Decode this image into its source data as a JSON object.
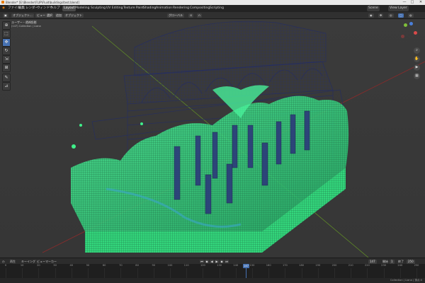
{
  "window": {
    "title": "Blender* [E:\\Blender\\FLIP\\Fluid\\buildings\\test.blend]",
    "controls": [
      "—",
      "□",
      "✕"
    ]
  },
  "menu": {
    "items": [
      "ファイル",
      "編集",
      "レンダー",
      "ウィンドウ",
      "ヘルプ"
    ],
    "workspaces": [
      "Layout",
      "Modeling",
      "Sculpting",
      "UV Editing",
      "Texture Paint",
      "Shading",
      "Animation",
      "Rendering",
      "Compositing",
      "Scripting"
    ],
    "active_workspace": "Layout",
    "scene": "Scene",
    "view_layer": "View Layer"
  },
  "header": {
    "mode": "オブジェクト...",
    "view": "ビュー",
    "select": "選択",
    "add": "追加",
    "object": "オブジェクト",
    "orientation": "グローバル",
    "pivot_icon": "pivot-icon",
    "snap_icon": "magnet-icon"
  },
  "viewport": {
    "overlay_title": "ユーザー・透視投影",
    "overlay_subtitle": "(147) Collection | Liana",
    "tools": [
      "cursor-icon",
      "select-box-icon",
      "move-icon",
      "rotate-icon",
      "scale-icon",
      "transform-icon",
      "annotate-icon",
      "measure-icon"
    ],
    "active_tool_index": 2,
    "nav_buttons": [
      "zoom-icon",
      "hand-icon",
      "camera-icon",
      "grid-icon"
    ],
    "colors": {
      "fluid": "#3ff08a",
      "fluid_dark": "#1a8a55",
      "mesh": "#26305e",
      "x_axis": "#a03030",
      "y_axis": "#6e9e2a"
    }
  },
  "timeline": {
    "header": [
      "再生",
      "キーイング",
      "ビュー",
      "マーカー"
    ],
    "current_frame": 147,
    "start_label": "開始",
    "start": 1,
    "end_label": "終了",
    "end": 250,
    "ticks": [
      0,
      10,
      20,
      30,
      40,
      50,
      60,
      70,
      80,
      90,
      100,
      110,
      120,
      130,
      140,
      150,
      160,
      170,
      180,
      190,
      200,
      210,
      220,
      230,
      240,
      250
    ],
    "playback_icons": [
      "jump-start-icon",
      "prev-key-icon",
      "play-reverse-icon",
      "play-icon",
      "next-key-icon",
      "jump-end-icon"
    ]
  },
  "status": {
    "right": "Collection | Liana | 頂点:0"
  }
}
